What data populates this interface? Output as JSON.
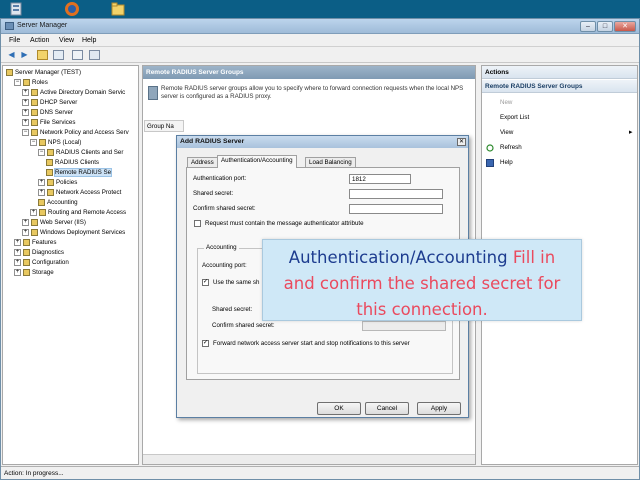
{
  "window": {
    "title": "Server Manager"
  },
  "menu": [
    "File",
    "Action",
    "View",
    "Help"
  ],
  "tree": {
    "items": [
      {
        "label": "Server Manager (TEST)",
        "level": 0,
        "expander": "",
        "icon": "server-icon"
      },
      {
        "label": "Roles",
        "level": 1,
        "expander": "−",
        "icon": "roles-icon"
      },
      {
        "label": "Active Directory Domain Servic",
        "level": 2,
        "expander": "+",
        "icon": "ad-icon"
      },
      {
        "label": "DHCP Server",
        "level": 2,
        "expander": "+",
        "icon": "dhcp-icon"
      },
      {
        "label": "DNS Server",
        "level": 2,
        "expander": "+",
        "icon": "dns-icon"
      },
      {
        "label": "File Services",
        "level": 2,
        "expander": "+",
        "icon": "file-icon"
      },
      {
        "label": "Network Policy and Access Serv",
        "level": 2,
        "expander": "−",
        "icon": "npas-icon"
      },
      {
        "label": "NPS (Local)",
        "level": 3,
        "expander": "−",
        "icon": "nps-icon"
      },
      {
        "label": "RADIUS Clients and Ser",
        "level": 4,
        "expander": "−",
        "icon": "folder-icon"
      },
      {
        "label": "RADIUS Clients",
        "level": 5,
        "expander": "",
        "icon": "clients-icon"
      },
      {
        "label": "Remote RADIUS Se",
        "level": 5,
        "expander": "",
        "icon": "remote-icon",
        "selected": true
      },
      {
        "label": "Policies",
        "level": 4,
        "expander": "+",
        "icon": "folder-icon"
      },
      {
        "label": "Network Access Protect",
        "level": 4,
        "expander": "+",
        "icon": "folder-icon"
      },
      {
        "label": "Accounting",
        "level": 4,
        "expander": "",
        "icon": "accounting-icon"
      },
      {
        "label": "Routing and Remote Access",
        "level": 3,
        "expander": "+",
        "icon": "routing-icon"
      },
      {
        "label": "Web Server (IIS)",
        "level": 2,
        "expander": "+",
        "icon": "iis-icon"
      },
      {
        "label": "Windows Deployment Services",
        "level": 2,
        "expander": "+",
        "icon": "wds-icon"
      },
      {
        "label": "Features",
        "level": 1,
        "expander": "+",
        "icon": "features-icon"
      },
      {
        "label": "Diagnostics",
        "level": 1,
        "expander": "+",
        "icon": "diagnostics-icon"
      },
      {
        "label": "Configuration",
        "level": 1,
        "expander": "+",
        "icon": "configuration-icon"
      },
      {
        "label": "Storage",
        "level": 1,
        "expander": "+",
        "icon": "storage-icon"
      }
    ]
  },
  "center": {
    "header": "Remote RADIUS Server Groups",
    "description": "Remote RADIUS server groups allow you to specify where to forward connection requests when the local NPS server is configured as a RADIUS proxy.",
    "grid_header": "Group Na"
  },
  "actions": {
    "header": "Actions",
    "section": "Remote RADIUS Server Groups",
    "items": [
      {
        "label": "New",
        "enabled": false
      },
      {
        "label": "Export List",
        "enabled": true
      },
      {
        "label": "View",
        "enabled": true,
        "submenu": true
      },
      {
        "label": "Refresh",
        "enabled": true
      },
      {
        "label": "Help",
        "enabled": true
      }
    ]
  },
  "status": "Action:  In progress...",
  "dialog": {
    "title": "Add RADIUS Server",
    "tabs": [
      "Address",
      "Authentication/Accounting",
      "Load Balancing"
    ],
    "active_tab": "Authentication/Accounting",
    "auth_port_label": "Authentication port:",
    "auth_port_value": "1812",
    "shared_secret_label": "Shared secret:",
    "confirm_secret_label": "Confirm shared secret:",
    "require_auth_label": "Request must contain the message authenticator attribute",
    "require_auth_checked": false,
    "accounting_legend": "Accounting",
    "acct_port_label": "Accounting port:",
    "use_same_label": "Use the same sh",
    "use_same_checked": true,
    "acct_shared_secret_label": "Shared secret:",
    "acct_confirm_secret_label": "Confirm shared secret:",
    "forward_label": "Forward network access server start and stop notifications to this server",
    "forward_checked": true,
    "ok": "OK",
    "cancel": "Cancel",
    "apply": "Apply"
  },
  "callout": {
    "heading": "Authentication/Accounting",
    "body": "Fill in and confirm the shared secret for this connection."
  }
}
